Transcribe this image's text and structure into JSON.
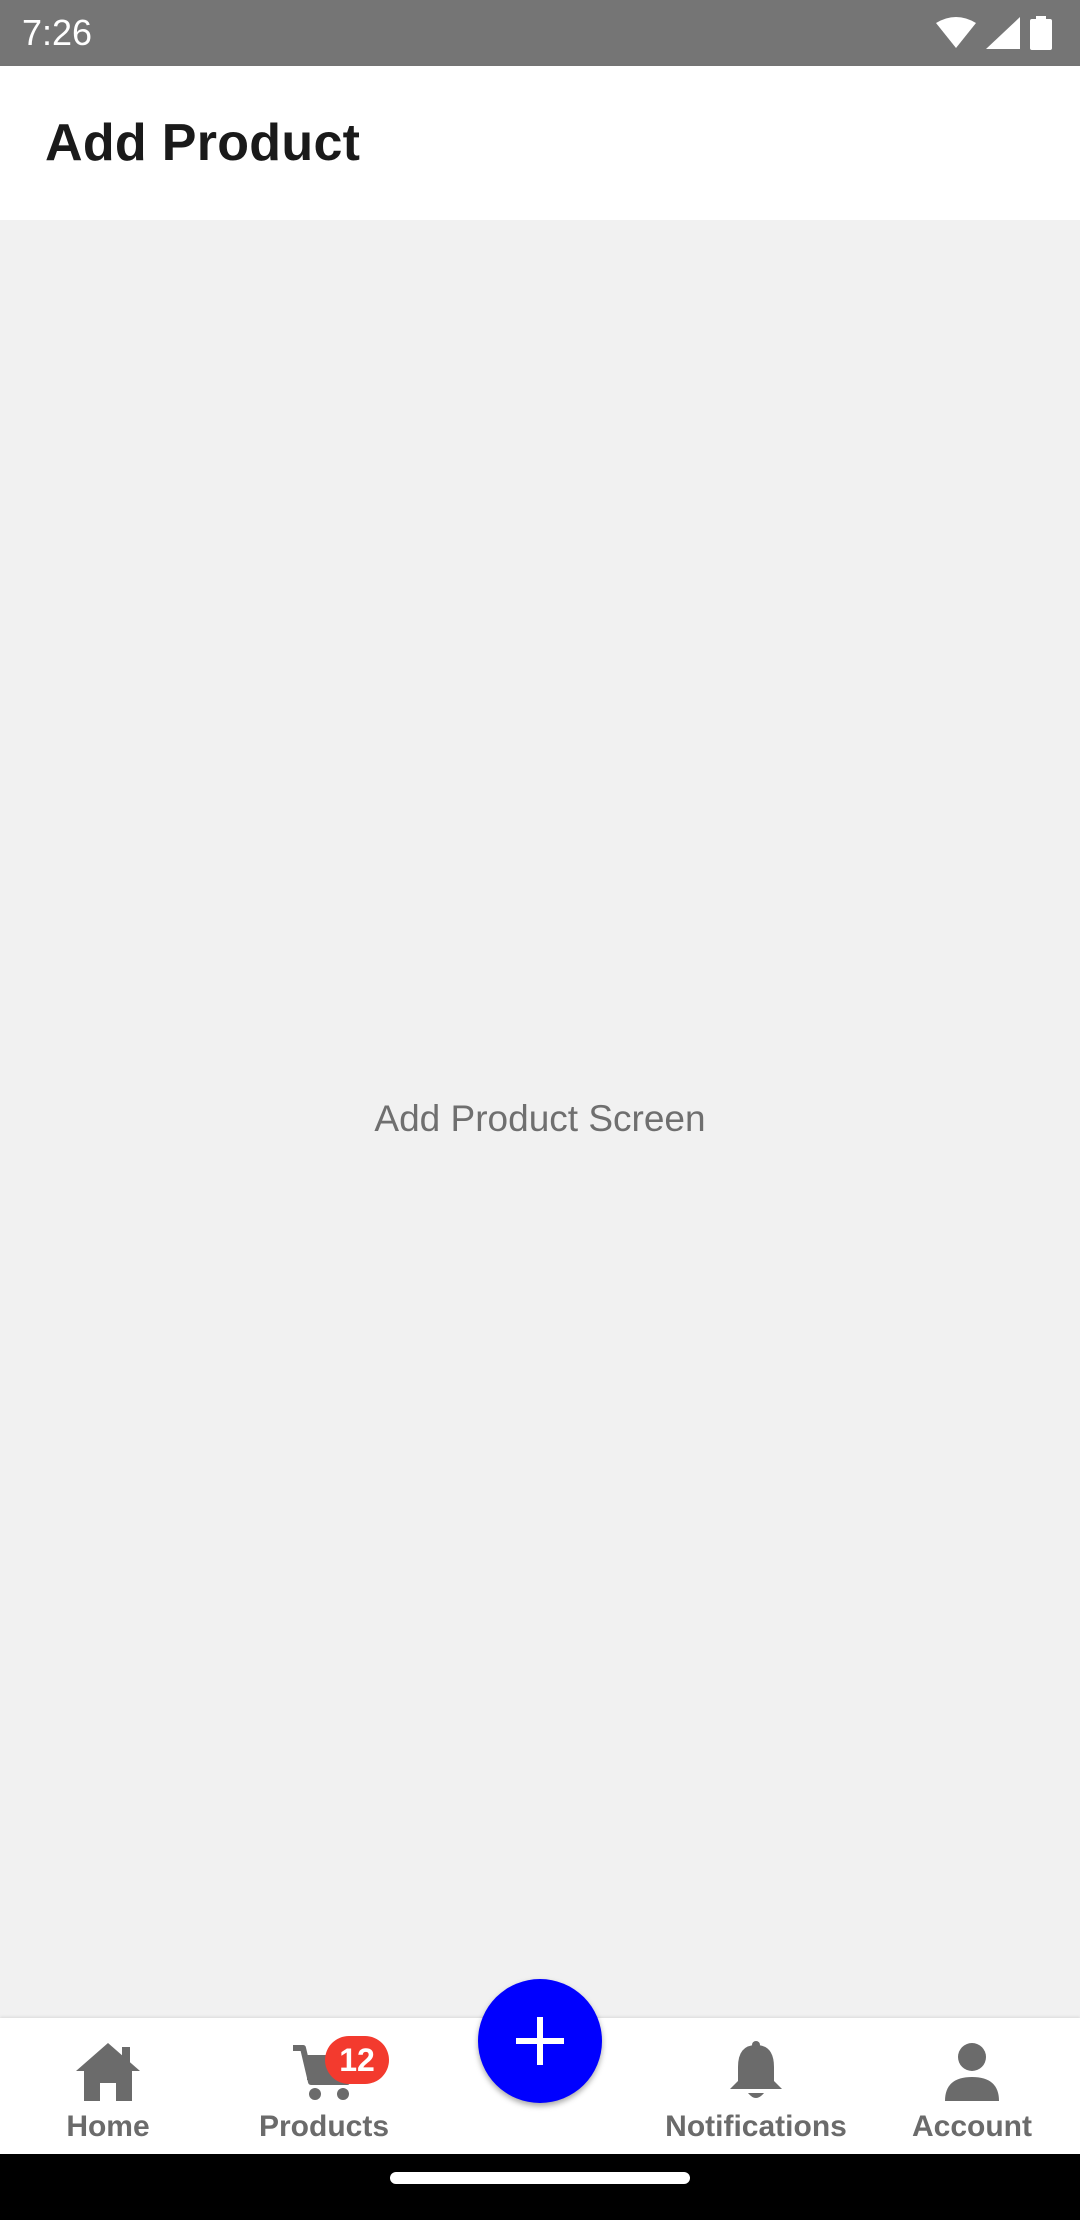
{
  "status_bar": {
    "time": "7:26"
  },
  "app_bar": {
    "title": "Add Product"
  },
  "main": {
    "placeholder_text": "Add Product Screen"
  },
  "bottom_nav": {
    "items": [
      {
        "label": "Home",
        "icon": "home-icon"
      },
      {
        "label": "Products",
        "icon": "cart-icon",
        "badge": "12"
      },
      {
        "label": "Notifications",
        "icon": "bell-icon"
      },
      {
        "label": "Account",
        "icon": "person-icon"
      }
    ],
    "fab_icon": "plus-icon"
  },
  "colors": {
    "fab": "#0000ff",
    "badge": "#f33a2e",
    "nav_icon": "#6b6b6b",
    "status_bar": "#757575"
  }
}
